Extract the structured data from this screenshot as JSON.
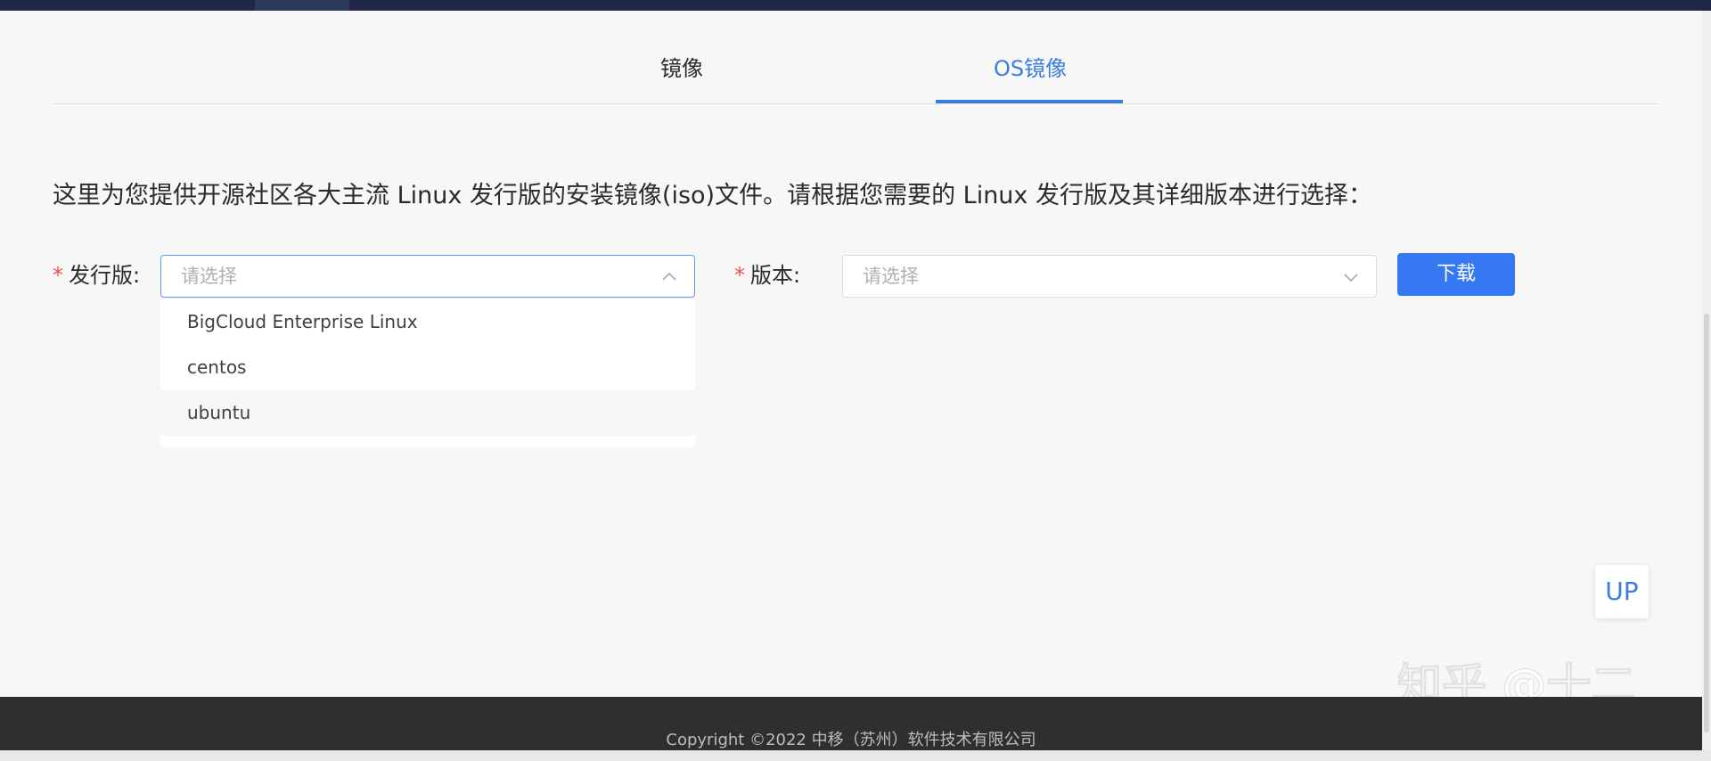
{
  "tabs": [
    {
      "label": "镜像",
      "active": false
    },
    {
      "label": "OS镜像",
      "active": true
    }
  ],
  "intro": "这里为您提供开源社区各大主流 Linux 发行版的安装镜像(iso)文件。请根据您需要的 Linux 发行版及其详细版本进行选择：",
  "form": {
    "required_mark": "*",
    "distro": {
      "label": "发行版:",
      "placeholder": "请选择",
      "options": [
        "BigCloud Enterprise Linux",
        "centos",
        "ubuntu"
      ],
      "hovered_option": "ubuntu",
      "open": true
    },
    "version": {
      "label": "版本:",
      "placeholder": "请选择",
      "open": false
    },
    "download_label": "下载"
  },
  "up_label": "UP",
  "watermark": "知乎 @十二",
  "footer": {
    "copyright": "Copyright ©2022 中移（苏州）软件技术有限公司"
  },
  "colors": {
    "accent": "#3b7ddd",
    "button": "#3578f1",
    "required": "#e6554f",
    "footer_bg": "#2f2f2f",
    "topbar": "#22274a"
  },
  "icons": {
    "distro_select": "chevron-up-icon",
    "version_select": "chevron-down-icon"
  }
}
